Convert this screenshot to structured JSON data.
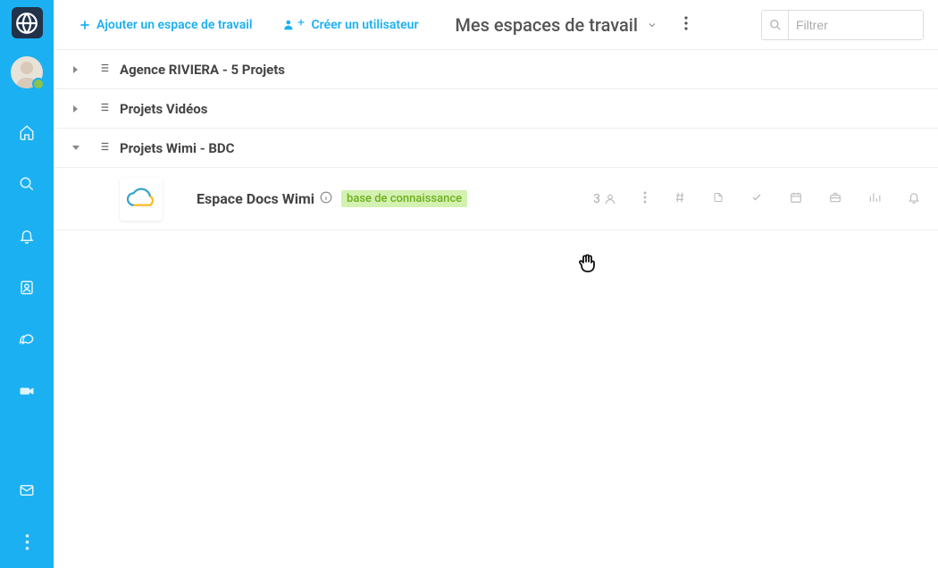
{
  "sidebar": {
    "status": "online"
  },
  "topbar": {
    "add_workspace": "Ajouter un espace de travail",
    "create_user": "Créer un utilisateur",
    "title": "Mes espaces de travail",
    "filter_placeholder": "Filtrer"
  },
  "groups": [
    {
      "label": "Agence RIVIERA - 5 Projets",
      "expanded": false
    },
    {
      "label": "Projets Vidéos",
      "expanded": false
    },
    {
      "label": "Projets Wimi - BDC",
      "expanded": true
    }
  ],
  "workspace": {
    "title": "Espace Docs Wimi",
    "tag": "base de connaissance",
    "member_count": "3"
  }
}
